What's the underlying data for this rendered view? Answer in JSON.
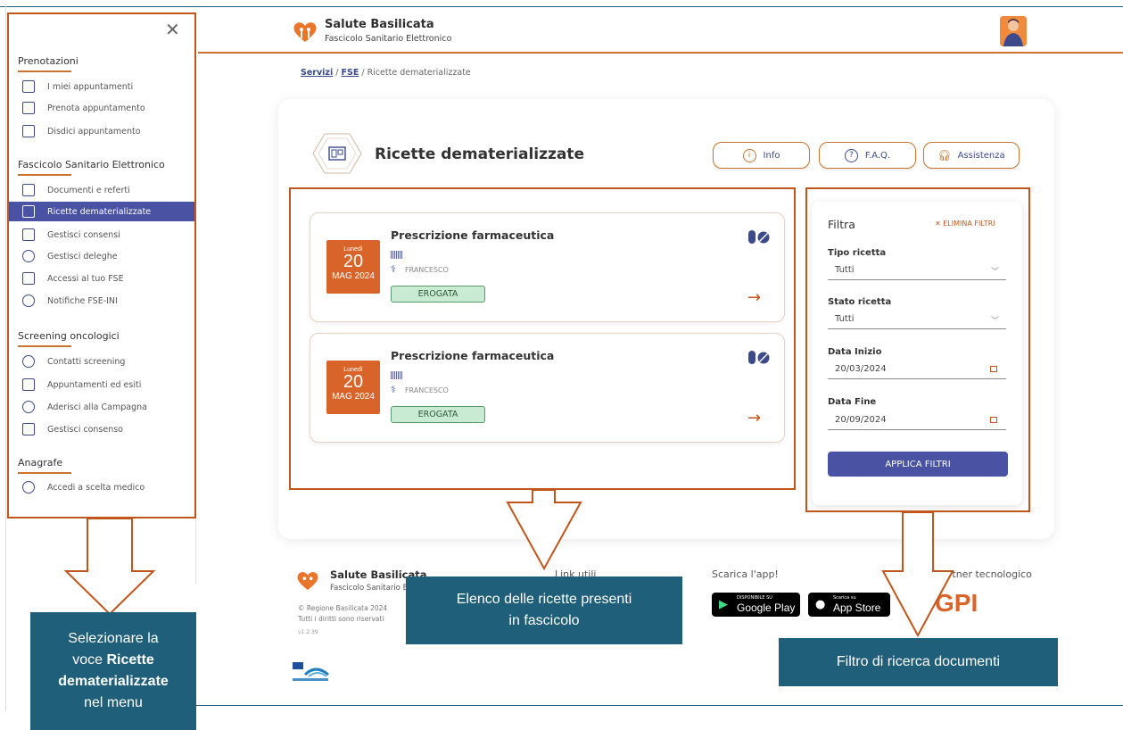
{
  "sidebar": {
    "sections": [
      {
        "title": "Prenotazioni",
        "items": [
          "I miei appuntamenti",
          "Prenota appuntamento",
          "Disdici appuntamento"
        ]
      },
      {
        "title": "Fascicolo Sanitario Elettronico",
        "items": [
          "Documenti e referti",
          "Ricette dematerializzate",
          "Gestisci consensi",
          "Gestisci deleghe",
          "Accessi al tuo FSE",
          "Notifiche FSE-INI"
        ]
      },
      {
        "title": "Screening oncologici",
        "items": [
          "Contatti screening",
          "Appuntamenti ed esiti",
          "Aderisci alla Campagna",
          "Gestisci consenso"
        ]
      },
      {
        "title": "Anagrafe",
        "items": [
          "Accedi a scelta medico"
        ]
      }
    ],
    "active_item": "Ricette dematerializzate"
  },
  "header": {
    "brand": "Salute Basilicata",
    "subtitle": "Fascicolo Sanitario Elettronico"
  },
  "breadcrumb": {
    "servizi": "Servizi",
    "fse": "FSE",
    "sep": "/",
    "current": "Ricette dematerializzate"
  },
  "page": {
    "title": "Ricette dematerializzate",
    "buttons": {
      "info": "Info",
      "faq": "F.A.Q.",
      "assistenza": "Assistenza"
    }
  },
  "prescriptions": [
    {
      "title": "Prescrizione farmaceutica",
      "weekday": "Lunedì",
      "day": "20",
      "month_year": "MAG 2024",
      "doctor": "FRANCESCO",
      "status": "EROGATA"
    },
    {
      "title": "Prescrizione farmaceutica",
      "weekday": "Lunedì",
      "day": "20",
      "month_year": "MAG 2024",
      "doctor": "FRANCESCO",
      "status": "EROGATA"
    }
  ],
  "filter": {
    "title": "Filtra",
    "clear": "ELIMINA FILTRI",
    "tipo_label": "Tipo ricetta",
    "tipo_value": "Tutti",
    "stato_label": "Stato ricetta",
    "stato_value": "Tutti",
    "inizio_label": "Data Inizio",
    "inizio_value": "20/03/2024",
    "fine_label": "Data Fine",
    "fine_value": "20/09/2024",
    "apply": "APPLICA FILTRI"
  },
  "footer": {
    "brand": "Salute Basilicata",
    "subtitle": "Fascicolo Sanitario Elettronico",
    "copyright": "© Regione Basilicata 2024",
    "rights": "Tutti i diritti sono riservati",
    "version": "v1.2.39",
    "links_title": "Link utili",
    "app_title": "Scarica l'app!",
    "google_small": "DISPONIBILE SU",
    "google_big": "Google Play",
    "apple_small": "Scarica su",
    "apple_big": "App Store",
    "partner_title": "Partner tecnologico",
    "partner_logo": "GPI"
  },
  "callouts": {
    "menu_line1": "Selezionare la",
    "menu_line2a": "voce ",
    "menu_line2b": "Ricette",
    "menu_line3": "dematerializzate",
    "menu_line4": "nel menu",
    "list_line1": "Elenco delle ricette presenti",
    "list_line2": "in fascicolo",
    "filter": "Filtro di ricerca documenti"
  },
  "colors": {
    "accent": "#c9742e",
    "primary": "#4a52a3",
    "callout": "#1f5f7a",
    "badge": "#d9642a"
  }
}
